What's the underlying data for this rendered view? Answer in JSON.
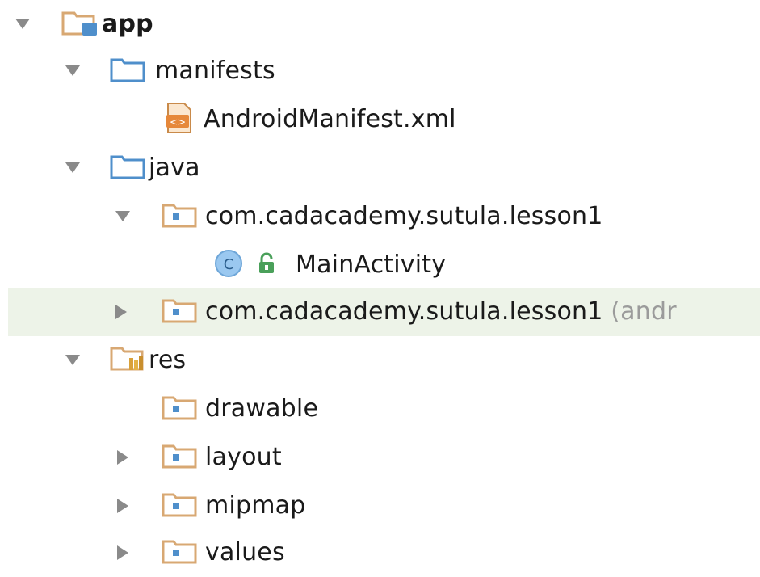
{
  "tree": {
    "app": {
      "label": "app",
      "icon": "android-module-folder-icon"
    },
    "manifests": {
      "label": "manifests",
      "icon": "folder-icon"
    },
    "android_manifest": {
      "label": "AndroidManifest.xml",
      "icon": "xml-file-icon"
    },
    "java": {
      "label": "java",
      "icon": "folder-icon"
    },
    "package_main": {
      "label": "com.cadacademy.sutula.lesson1",
      "icon": "package-folder-icon"
    },
    "main_activity": {
      "label": "MainActivity",
      "icon": "java-class-icon",
      "badge_icon": "unlocked-lock-icon",
      "class_letter": "C"
    },
    "package_test": {
      "label": "com.cadacademy.sutula.lesson1",
      "suffix": "(andr",
      "icon": "package-folder-icon"
    },
    "res": {
      "label": "res",
      "icon": "resources-folder-icon"
    },
    "drawable": {
      "label": "drawable",
      "icon": "package-folder-icon"
    },
    "layout": {
      "label": "layout",
      "icon": "package-folder-icon"
    },
    "mipmap": {
      "label": "mipmap",
      "icon": "package-folder-icon"
    },
    "values": {
      "label": "values",
      "icon": "package-folder-icon"
    }
  },
  "colors": {
    "selection_background": "#edf3e8",
    "folder_tan": "#d8a873",
    "folder_blue": "#4f8fcb",
    "class_circle": "#9ac8f0",
    "lock_green": "#4aa05a",
    "suffix_gray": "#9b9b9b"
  }
}
